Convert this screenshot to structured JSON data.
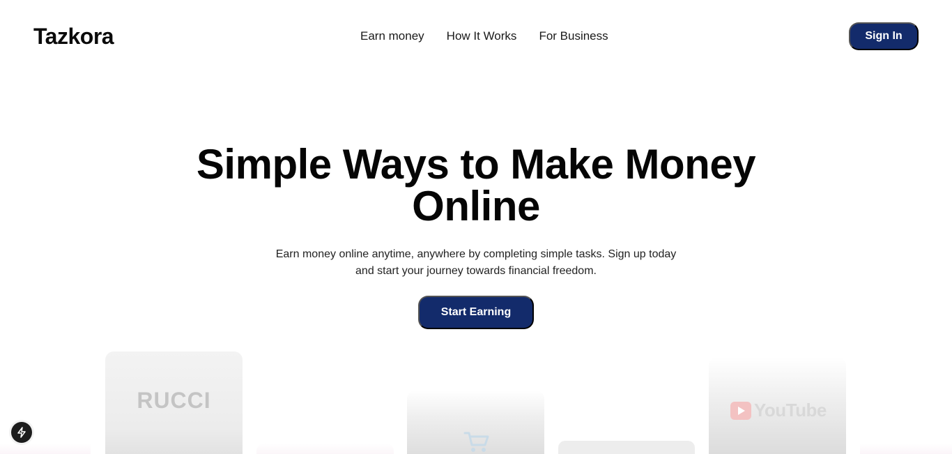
{
  "header": {
    "logo": "Tazkora",
    "nav": [
      "Earn money",
      "How It Works",
      "For Business"
    ],
    "signin_label": "Sign In"
  },
  "hero": {
    "title_line1": "Simple Ways to Make Money",
    "title_line2": "Online",
    "subtitle_line1": "Earn money online anytime, anywhere by completing simple tasks. Sign up today",
    "subtitle_line2": "and start your journey towards financial freedom.",
    "cta_label": "Start Earning"
  },
  "cards": {
    "card1_brand": "RUCCI",
    "card5_brand": "YouTube"
  },
  "icons": {
    "badge": "bolt-icon",
    "cart": "shopping-cart-icon",
    "youtube": "youtube-play-icon"
  },
  "colors": {
    "primary": "#132b6b",
    "text": "#111111",
    "background": "#ffffff"
  }
}
